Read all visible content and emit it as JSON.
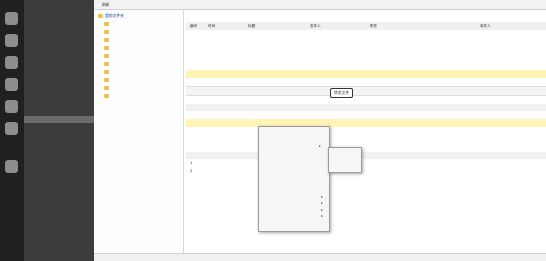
{
  "toolbar": [
    "刷新",
    "",
    ""
  ],
  "nav": {
    "items": [
      "",
      "",
      "",
      "",
      "",
      "",
      "",
      "",
      "",
      "",
      "",
      "",
      "",
      "",
      "",
      "",
      "",
      "",
      "",
      "",
      "",
      "",
      "",
      "",
      "",
      "",
      "",
      "",
      "",
      "",
      "",
      ""
    ],
    "selected_index": 14
  },
  "tree": {
    "root": "我的文件夹",
    "items": [
      "",
      "",
      "",
      "",
      "",
      "",
      "",
      "",
      "",
      ""
    ]
  },
  "table1": {
    "headers": [
      "编号",
      "时间",
      "标题",
      "发件人",
      "附件",
      "收件人"
    ],
    "rows": [
      [
        "",
        "",
        "",
        "",
        "",
        ""
      ],
      [
        "",
        "",
        "",
        "",
        "",
        ""
      ],
      [
        "",
        "",
        "",
        "",
        "",
        ""
      ],
      [
        "",
        "",
        "",
        "",
        "",
        ""
      ],
      [
        "",
        "",
        "",
        "",
        "",
        ""
      ],
      [
        "",
        "",
        "",
        "",
        "",
        ""
      ],
      [
        "",
        "",
        "",
        "",
        "",
        ""
      ]
    ],
    "highlight_row": 5
  },
  "actions": {
    "buttons": [
      "",
      "",
      "",
      "",
      ""
    ],
    "outlined": "转发文件"
  },
  "table2": {
    "title": "",
    "headers": [
      "",
      "",
      "",
      "",
      "",
      ""
    ],
    "rows": [
      [
        "",
        "",
        "",
        "",
        "",
        ""
      ],
      [
        "",
        "",
        "",
        "",
        "",
        ""
      ]
    ]
  },
  "table3": {
    "title": "",
    "headers": [
      "",
      "",
      "",
      ""
    ],
    "rows": [
      [
        "1",
        "",
        "",
        "",
        ""
      ],
      [
        "2",
        "",
        "",
        "",
        ""
      ]
    ]
  },
  "context_menu": {
    "items": [
      "",
      "",
      "",
      "",
      "",
      "",
      "",
      "",
      "",
      "",
      "",
      "",
      "",
      "",
      "",
      ""
    ],
    "highlight_index": 2
  },
  "submenu": {
    "items": [
      "",
      "",
      ""
    ],
    "highlight_index": 1
  },
  "status": ""
}
